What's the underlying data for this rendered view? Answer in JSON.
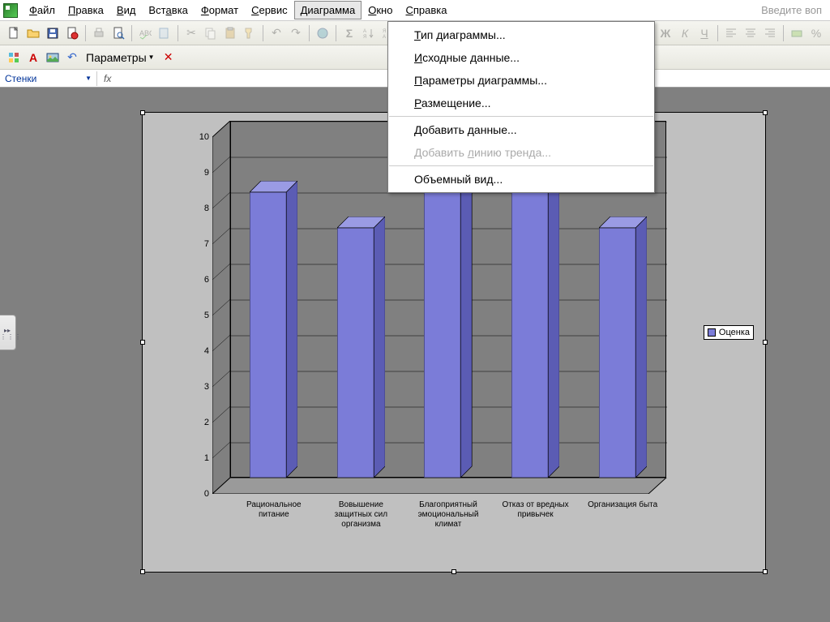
{
  "menubar": {
    "items": [
      {
        "label": "Файл",
        "u": 0
      },
      {
        "label": "Правка",
        "u": 0
      },
      {
        "label": "Вид",
        "u": 0
      },
      {
        "label": "Вставка",
        "u": 3
      },
      {
        "label": "Формат",
        "u": 0
      },
      {
        "label": "Сервис",
        "u": 0
      },
      {
        "label": "Диаграмма",
        "u": 0
      },
      {
        "label": "Окно",
        "u": 0
      },
      {
        "label": "Справка",
        "u": 0
      }
    ],
    "help_placeholder": "Введите воп"
  },
  "toolbar2": {
    "params_label": "Параметры"
  },
  "namebox": {
    "value": "Стенки"
  },
  "formula_fx": "fx",
  "dropdown": {
    "items": [
      {
        "label": "Тип диаграммы...",
        "enabled": true,
        "u": 0
      },
      {
        "label": "Исходные данные...",
        "enabled": true,
        "u": 0
      },
      {
        "label": "Параметры диаграммы...",
        "enabled": true,
        "u": 0
      },
      {
        "label": "Размещение...",
        "enabled": true,
        "u": 0
      },
      {
        "label": "Добавить данные...",
        "enabled": true,
        "u": -1,
        "sep_before": true
      },
      {
        "label": "Добавить линию тренда...",
        "enabled": false,
        "u": 9
      },
      {
        "label": "Объемный вид...",
        "enabled": true,
        "u": -1,
        "sep_before": true
      }
    ]
  },
  "legend": {
    "label": "Оценка"
  },
  "chart_data": {
    "type": "bar",
    "categories": [
      "Рациональное питание",
      "Вовышение защитных сил организма",
      "Благоприятный эмоциональный климат",
      "Отказ от вредных привычек",
      "Организация быта"
    ],
    "values": [
      8,
      7,
      9.5,
      9.5,
      7
    ],
    "series_name": "Оценка",
    "ylim": [
      0,
      10
    ],
    "ytick_step": 1,
    "xlabel": "",
    "ylabel": "",
    "title": ""
  }
}
